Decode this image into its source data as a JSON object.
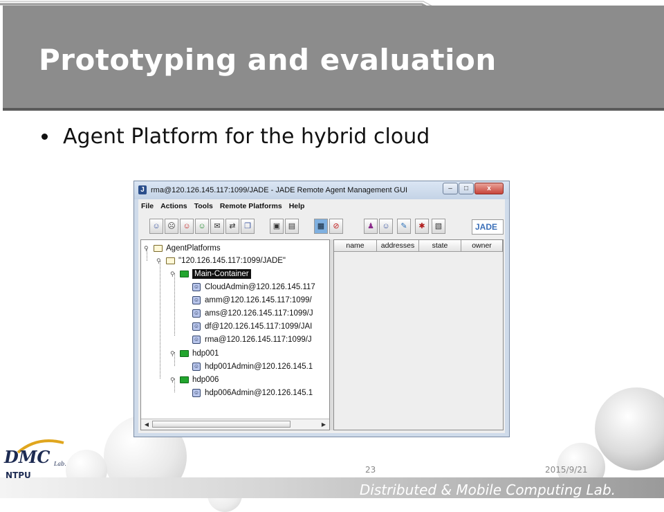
{
  "slide": {
    "title": "Prototyping and evaluation",
    "bullet": "Agent Platform for the hybrid cloud",
    "page_number": "23",
    "date": "2015/9/21",
    "footer": "Distributed & Mobile Computing Lab.",
    "logo": {
      "main": "DMC",
      "sub": "Lab.",
      "school": "NTPU"
    }
  },
  "window": {
    "title": "rma@120.126.145.117:1099/JADE - JADE Remote Agent Management GUI",
    "controls": {
      "minimize": "–",
      "maximize": "□",
      "close": "x"
    },
    "menu": [
      "File",
      "Actions",
      "Tools",
      "Remote Platforms",
      "Help"
    ],
    "toolbar_icons": [
      "new-agent-icon",
      "kill-agent-icon",
      "suspend-agent-icon",
      "resume-agent-icon",
      "send-message-icon",
      "migrate-agent-icon",
      "clone-agent-icon",
      "save-agent-icon",
      "freeze-agent-icon",
      "show-gui-icon",
      "close-rma-icon",
      "dummy-agent-icon",
      "df-gui-icon",
      "sniffer-icon",
      "introspector-icon",
      "log-manager-icon"
    ],
    "jade_logo": "JADE",
    "tree": {
      "root": "AgentPlatforms",
      "platform": "\"120.126.145.117:1099/JADE\"",
      "containers": [
        {
          "name": "Main-Container",
          "selected": true,
          "agents": [
            "CloudAdmin@120.126.145.117",
            "amm@120.126.145.117:1099/",
            "ams@120.126.145.117:1099/J",
            "df@120.126.145.117:1099/JAI",
            "rma@120.126.145.117:1099/J"
          ]
        },
        {
          "name": "hdp001",
          "selected": false,
          "agents": [
            "hdp001Admin@120.126.145.1"
          ]
        },
        {
          "name": "hdp006",
          "selected": false,
          "agents": [
            "hdp006Admin@120.126.145.1"
          ]
        }
      ]
    },
    "table_columns": [
      "name",
      "addresses",
      "state",
      "owner"
    ]
  },
  "colors": {
    "title_bar": "#8c8c8c",
    "selection": "#111111",
    "container_folder": "#22a52e"
  }
}
